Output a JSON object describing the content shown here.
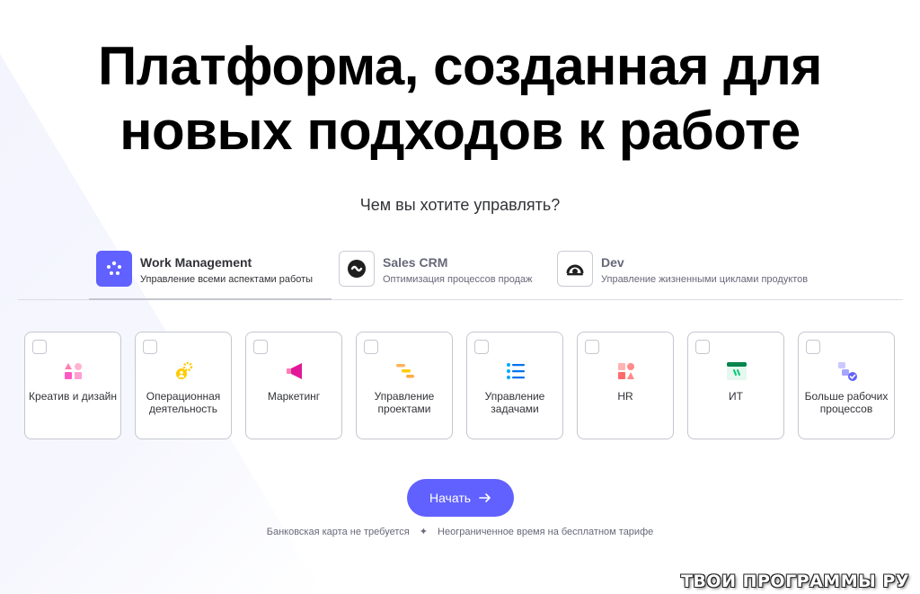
{
  "hero": {
    "title_line1": "Платформа, созданная для",
    "title_line2": "новых подходов к работе",
    "subtitle": "Чем вы хотите управлять?"
  },
  "tabs": [
    {
      "name": "Work Management",
      "description": "Управление всеми аспектами работы",
      "icon": "work-management-dots-icon",
      "active": true
    },
    {
      "name": "Sales CRM",
      "description": "Оптимизация процессов продаж",
      "icon": "sales-crm-icon",
      "active": false
    },
    {
      "name": "Dev",
      "description": "Управление жизненными циклами продуктов",
      "icon": "dev-icon",
      "active": false
    }
  ],
  "cards": [
    {
      "label": "Креатив и дизайн",
      "icon": "creative-shapes-icon",
      "checked": false
    },
    {
      "label": "Операционная деятельность",
      "icon": "operations-gears-icon",
      "checked": false
    },
    {
      "label": "Маркетинг",
      "icon": "megaphone-icon",
      "checked": false
    },
    {
      "label": "Управление проектами",
      "icon": "gantt-icon",
      "checked": false
    },
    {
      "label": "Управление задачами",
      "icon": "checklist-icon",
      "checked": false
    },
    {
      "label": "HR",
      "icon": "hr-shapes-icon",
      "checked": false
    },
    {
      "label": "ИТ",
      "icon": "it-window-icon",
      "checked": false
    },
    {
      "label": "Больше рабочих процессов",
      "icon": "workflow-icon",
      "checked": false
    }
  ],
  "cta": {
    "label": "Начать",
    "icon": "arrow-right-icon"
  },
  "footnote": {
    "left": "Банковская карта не требуется",
    "separator": "✦",
    "right": "Неограниченное время на бесплатном тарифе"
  },
  "watermark": "ТВОИ ПРОГРАММЫ РУ",
  "colors": {
    "accent": "#6161ff",
    "text": "#323338",
    "border": "#c5c7d0"
  }
}
